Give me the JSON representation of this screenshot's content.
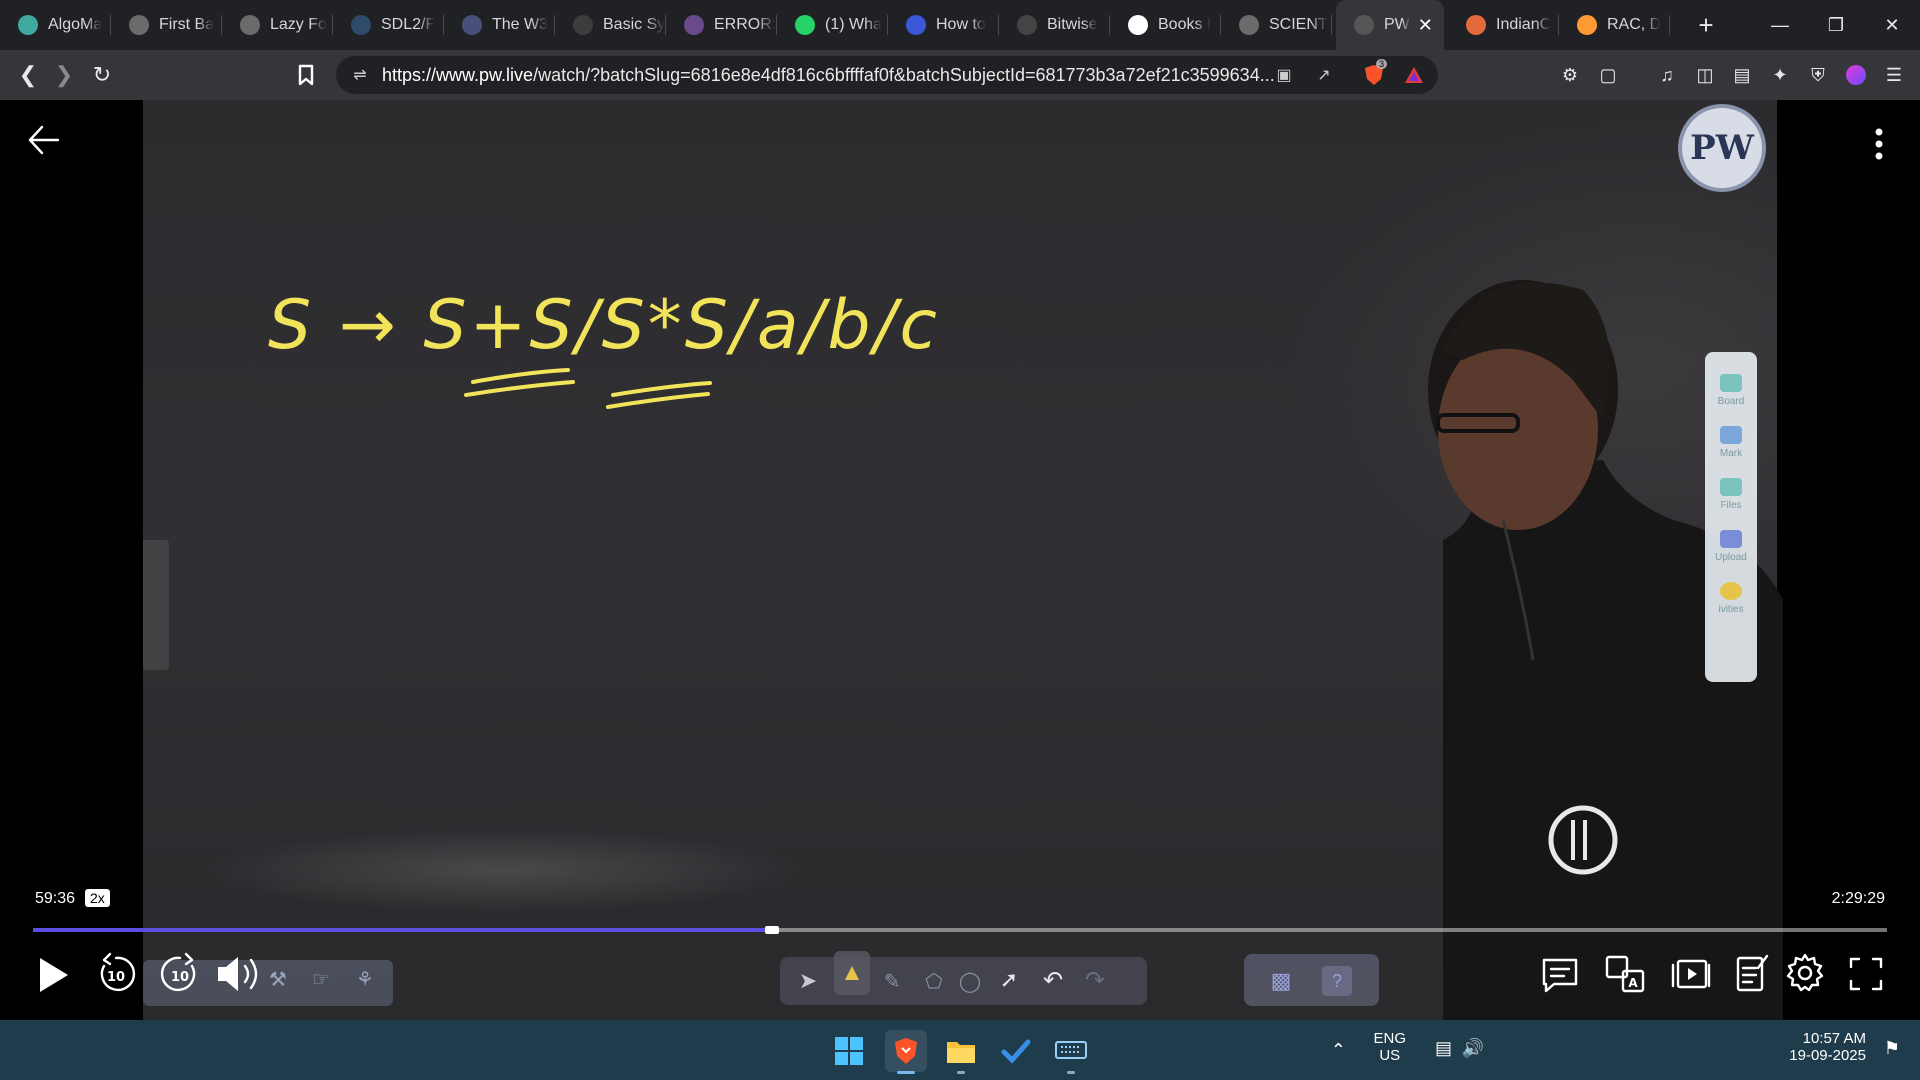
{
  "browser": {
    "tabs": [
      {
        "title": "AlgoMa",
        "icon": "algomaster-icon",
        "color": "#3fa9a0"
      },
      {
        "title": "First Ba",
        "icon": "bitcoin-icon",
        "color": "#6b6b6b"
      },
      {
        "title": "Lazy Fo",
        "icon": "globe-icon",
        "color": "#6b6b6b"
      },
      {
        "title": "SDL2/F",
        "icon": "sdl-icon",
        "color": "#304a6a"
      },
      {
        "title": "The W3",
        "icon": "w3-icon",
        "color": "#4a4f7a"
      },
      {
        "title": "Basic Sy",
        "icon": "basic-icon",
        "color": "#3c3c3c"
      },
      {
        "title": "ERROR:",
        "icon": "error-icon",
        "color": "#6a4a8a"
      },
      {
        "title": "(1) Wha",
        "icon": "whatsapp-icon",
        "color": "#25d366"
      },
      {
        "title": "How to",
        "icon": "howto-icon",
        "color": "#3a57d8"
      },
      {
        "title": "Bitwise",
        "icon": "bitwise-icon",
        "color": "#444"
      },
      {
        "title": "Books I",
        "icon": "google-icon",
        "color": "#ffffff"
      },
      {
        "title": "SCIENT",
        "icon": "globe-icon",
        "color": "#6b6b6b"
      },
      {
        "title": "PW",
        "icon": "pw-icon",
        "color": "#555"
      },
      {
        "title": "IndianC",
        "icon": "indiancorp-icon",
        "color": "#e36a3a"
      },
      {
        "title": "RAC, D",
        "icon": "india-flag-icon",
        "color": "#ff9933"
      }
    ],
    "active_tab_index": 12,
    "url_domain": "https://www.pw.live",
    "url_path": "/watch/?batchSlug=6816e8e4df816c6bffffaf0f&batchSubjectId=681773b3a72ef21c3599634...",
    "brave_shield_count": "3"
  },
  "player": {
    "board_text": "S → S+S/S*S/a/b/c",
    "current_time": "59:36",
    "speed": "2x",
    "duration": "2:29:29",
    "progress_fraction": 0.3985,
    "side_tools": [
      "Board",
      "Mark",
      "Files",
      "Upload",
      "ivities"
    ],
    "colors": {
      "progress": "#5a4fe0",
      "chalk": "#f2e45a"
    }
  },
  "taskbar": {
    "lang_top": "ENG",
    "lang_bottom": "US",
    "time": "10:57 AM",
    "date": "19-09-2025"
  }
}
